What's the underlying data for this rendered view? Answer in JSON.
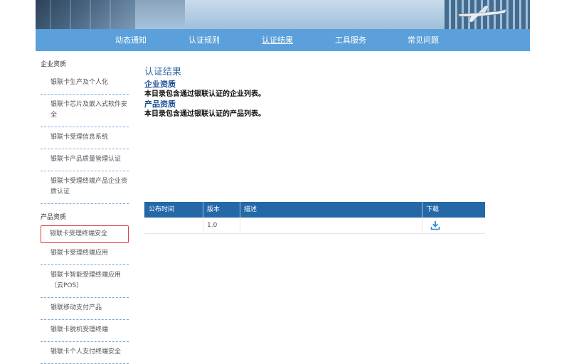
{
  "nav": {
    "items": [
      {
        "label": "动态通知",
        "active": false
      },
      {
        "label": "认证规则",
        "active": false
      },
      {
        "label": "认证结果",
        "active": true
      },
      {
        "label": "工具服务",
        "active": false
      },
      {
        "label": "常见问题",
        "active": false
      }
    ]
  },
  "sidebar": {
    "enterprise_category": "企业资质",
    "enterprise_items": [
      "银联卡生产及个人化",
      "银联卡芯片及嵌入式软件安全",
      "银联卡受理信息系统",
      "银联卡产品质量管理认证",
      "银联卡受理终端产品企业资质认证"
    ],
    "product_category": "产品资质",
    "product_items": [
      "银联卡受理终端安全",
      "银联卡受理终端应用",
      "银联卡智能受理终端应用（云POS）",
      "银联移动支付产品",
      "银联卡脱机受理终端",
      "银联卡个人支付终端安全"
    ],
    "selected_product_index": 0
  },
  "main": {
    "title": "认证结果",
    "sections": [
      {
        "heading": "企业资质",
        "desc": "本目录包含通过银联认证的企业列表。"
      },
      {
        "heading": "产品资质",
        "desc": "本目录包含通过银联认证的产品列表。"
      }
    ]
  },
  "table": {
    "headers": [
      "公布时间",
      "版本",
      "描述",
      "下载"
    ],
    "rows": [
      {
        "date": "",
        "version": "1.0",
        "desc": "",
        "download_icon": "download-icon"
      }
    ]
  },
  "colors": {
    "nav_bg": "#5ba0db",
    "table_header": "#2468a8",
    "title_blue": "#2e6da4",
    "heading_blue": "#1a4e95",
    "selected_border": "#e23a3a"
  }
}
